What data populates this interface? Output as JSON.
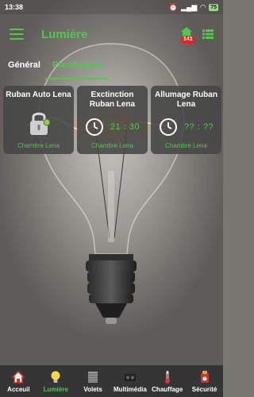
{
  "status_bar": {
    "time": "13:38",
    "battery": "75"
  },
  "app_bar": {
    "title": "Lumière",
    "notification_count": "141"
  },
  "tabs": [
    {
      "label": "Général",
      "active": false
    },
    {
      "label": "Planification",
      "active": true
    }
  ],
  "cards": [
    {
      "title": "Ruban Auto Lena",
      "room": "Chambre Lena",
      "icon": "lock-icon"
    },
    {
      "title": "Exctinction Ruban Lena",
      "time": "21 : 30",
      "room": "Chambre Lena",
      "icon": "clock-icon"
    },
    {
      "title": "Allumage Ruban Lena",
      "time": "?? : ??",
      "room": "Chambre Lena",
      "icon": "clock-icon"
    }
  ],
  "bottom_nav": [
    {
      "label": "Acceuil",
      "icon": "home-icon",
      "active": false
    },
    {
      "label": "Lumière",
      "icon": "bulb-icon",
      "active": true
    },
    {
      "label": "Volets",
      "icon": "shutter-icon",
      "active": false
    },
    {
      "label": "Multimédia",
      "icon": "media-icon",
      "active": false
    },
    {
      "label": "Chauffage",
      "icon": "thermometer-icon",
      "active": false
    },
    {
      "label": "Sécurité",
      "icon": "security-icon",
      "active": false
    }
  ],
  "colors": {
    "accent": "#4ec94a",
    "badge": "#e02424"
  }
}
